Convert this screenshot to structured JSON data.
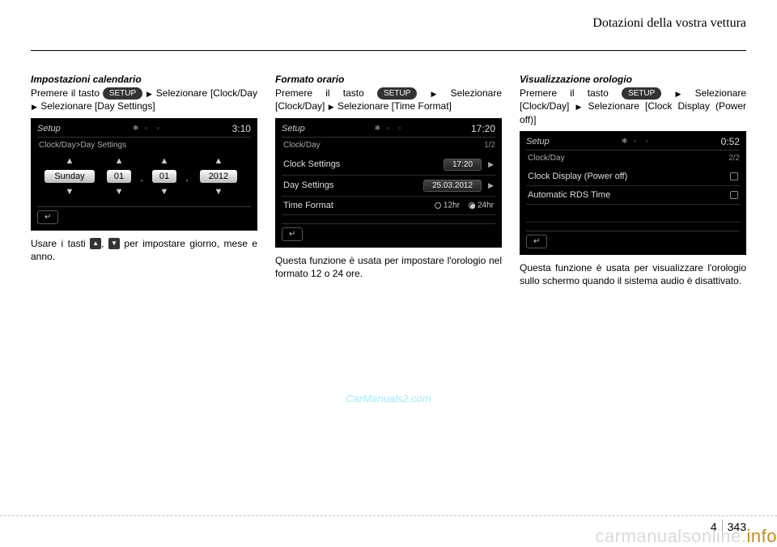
{
  "header": {
    "title": "Dotazioni della vostra vettura"
  },
  "buttons": {
    "setup": "SETUP"
  },
  "col1": {
    "subhead": "Impostazioni calendario",
    "instr_1a": "Premere il tasto ",
    "instr_1b": " Selezionare [Clock/Day ",
    "instr_1c": " Selezionare [Day Settings]",
    "note_a": "Usare i tasti ",
    "note_sep": ", ",
    "note_b": " per impostare giorno, mese e anno.",
    "screen": {
      "title": "Setup",
      "time": "3:10",
      "breadcrumb": "Clock/Day>Day Settings",
      "weekday": "Sunday",
      "day": "01",
      "month": "01",
      "year": "2012"
    }
  },
  "col2": {
    "subhead": "Formato orario",
    "instr_1a": "Premere il tasto ",
    "instr_1b": " Selezionare [Clock/Day] ",
    "instr_1c": " Selezionare [Time Format]",
    "note": "Questa funzione è usata per impostare l'orologio nel formato 12 o 24 ore.",
    "screen": {
      "title": "Setup",
      "time": "17:20",
      "breadcrumb": "Clock/Day",
      "pageind": "1/2",
      "row1_label": "Clock Settings",
      "row1_val": "17:20",
      "row2_label": "Day Settings",
      "row2_val": "25.03.2012",
      "row3_label": "Time Format",
      "opt12": "12hr",
      "opt24": "24hr"
    }
  },
  "col3": {
    "subhead": "Visualizzazione orologio",
    "instr_1a": "Premere il tasto ",
    "instr_1b": " Selezionare [Clock/Day] ",
    "instr_1c": " Selezionare [Clock Display (Power off)]",
    "note": "Questa funzione è usata per visualizzare l'orologio sullo schermo quando il sistema audio è disattivato.",
    "screen": {
      "title": "Setup",
      "time": "0:52",
      "breadcrumb": "Clock/Day",
      "pageind": "2/2",
      "row1_label": "Clock Display (Power off)",
      "row2_label": "Automatic RDS Time"
    }
  },
  "footer": {
    "watermark1": "CarManuals2.com",
    "chapter": "4",
    "page": "343",
    "watermark2a": "carmanualsonline.",
    "watermark2b": "info"
  }
}
